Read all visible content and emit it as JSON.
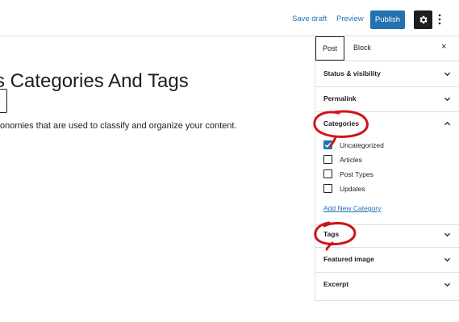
{
  "toolbar": {
    "save_draft": "Save draft",
    "preview": "Preview",
    "publish": "Publish"
  },
  "editor": {
    "title": "s Categories And Tags",
    "paragraph": "onomies that are used to classify and organize your content."
  },
  "sidebar": {
    "tabs": {
      "post": "Post",
      "block": "Block"
    },
    "close": "×",
    "panels": {
      "status": "Status & visibility",
      "permalink": "Permalink",
      "categories": "Categories",
      "tags": "Tags",
      "featured_image": "Featured image",
      "excerpt": "Excerpt"
    },
    "categories": [
      {
        "label": "Uncategorized",
        "checked": true
      },
      {
        "label": "Articles",
        "checked": false
      },
      {
        "label": "Post Types",
        "checked": false
      },
      {
        "label": "Updates",
        "checked": false
      }
    ],
    "add_new": "Add New Category"
  },
  "colors": {
    "accent": "#2271b1",
    "annotation": "#d0141b"
  },
  "icons": [
    "gear-icon",
    "kebab-menu-icon",
    "close-icon",
    "chevron-down-icon",
    "chevron-up-icon",
    "checkmark-icon"
  ]
}
